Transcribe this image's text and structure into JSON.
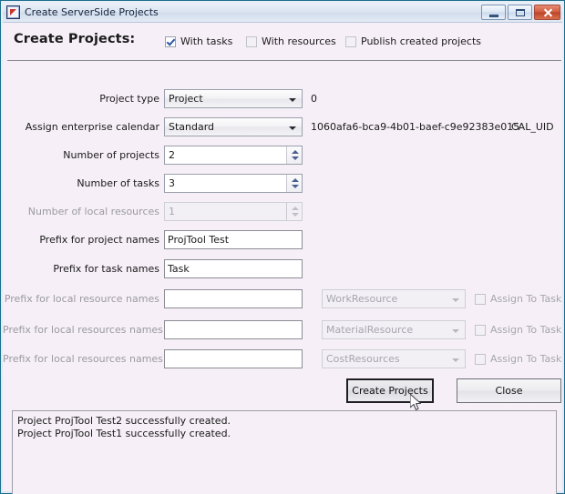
{
  "window": {
    "title": "Create ServerSide Projects",
    "icon": "app-icon",
    "controls": {
      "minimize": "minimize-icon",
      "maximize": "maximize-icon",
      "close": "close-icon"
    }
  },
  "header": {
    "title": "Create Projects:",
    "options": [
      {
        "label": "With tasks",
        "checked": true,
        "enabled": true
      },
      {
        "label": "With resources",
        "checked": false,
        "enabled": false
      },
      {
        "label": "Publish created projects",
        "checked": false,
        "enabled": false
      }
    ]
  },
  "form": {
    "project_type": {
      "label": "Project type",
      "value": "Project",
      "info": "0"
    },
    "enterprise_calendar": {
      "label": "Assign enterprise calendar",
      "value": "Standard",
      "info": "1060afa6-bca9-4b01-baef-c9e92383e015",
      "info2": "CAL_UID"
    },
    "number_of_projects": {
      "label": "Number of projects",
      "value": "2"
    },
    "number_of_tasks": {
      "label": "Number of tasks",
      "value": "3"
    },
    "number_of_local_resources": {
      "label": "Number of local resources",
      "value": "1"
    },
    "prefix_project_names": {
      "label": "Prefix for project names",
      "value": "ProjTool Test",
      "placeholder": ""
    },
    "prefix_task_names": {
      "label": "Prefix for task names",
      "value": "Task",
      "placeholder": ""
    },
    "resource_rows": [
      {
        "label": "Prefix for local resource names",
        "value": "",
        "placeholder": "",
        "type": "WorkResource",
        "assign_label": "Assign To Task",
        "assign_checked": false
      },
      {
        "label": "Prefix for local resources names",
        "value": "",
        "placeholder": "",
        "type": "MaterialResource",
        "assign_label": "Assign To Task",
        "assign_checked": false
      },
      {
        "label": "Prefix for local resources names",
        "value": "",
        "placeholder": "",
        "type": "CostResources",
        "assign_label": "Assign To Task",
        "assign_checked": false
      }
    ]
  },
  "buttons": {
    "create": "Create Projects",
    "close": "Close"
  },
  "log": {
    "lines": [
      "Project ProjTool Test2 successfully created.",
      "Project ProjTool Test1 successfully created."
    ]
  },
  "colors": {
    "background": "#f6eff7",
    "frame_border": "#1a6e8e",
    "close_button": "#cf5b3f",
    "check_mark": "#2a55a8"
  }
}
